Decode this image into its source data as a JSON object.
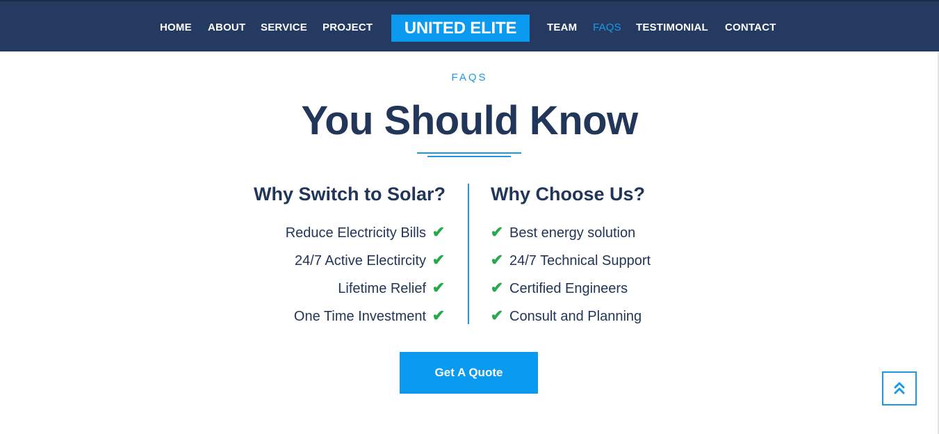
{
  "nav": {
    "left": [
      "HOME",
      "ABOUT",
      "SERVICE",
      "PROJECT"
    ],
    "brand": "UNITED ELITE",
    "right": [
      "TEAM",
      "FAQS",
      "TESTIMONIAL",
      "CONTACT"
    ],
    "active": "FAQS"
  },
  "section": {
    "eyebrow": "FAQS",
    "title": "You Should Know"
  },
  "left_column": {
    "title": "Why Switch to Solar?",
    "items": [
      "Reduce Electricity Bills",
      "24/7 Active Electircity",
      "Lifetime Relief",
      "One Time Investment"
    ]
  },
  "right_column": {
    "title": "Why Choose Us?",
    "items": [
      "Best energy solution",
      "24/7 Technical Support",
      "Certified Engineers",
      "Consult and Planning"
    ]
  },
  "cta": {
    "label": "Get A Quote"
  },
  "icons": {
    "check": "check-icon",
    "scroll_top": "double-chevron-up-icon"
  },
  "colors": {
    "navbar": "#243a60",
    "accent": "#0a9af0",
    "heading": "#213658",
    "check": "#27a84a"
  }
}
